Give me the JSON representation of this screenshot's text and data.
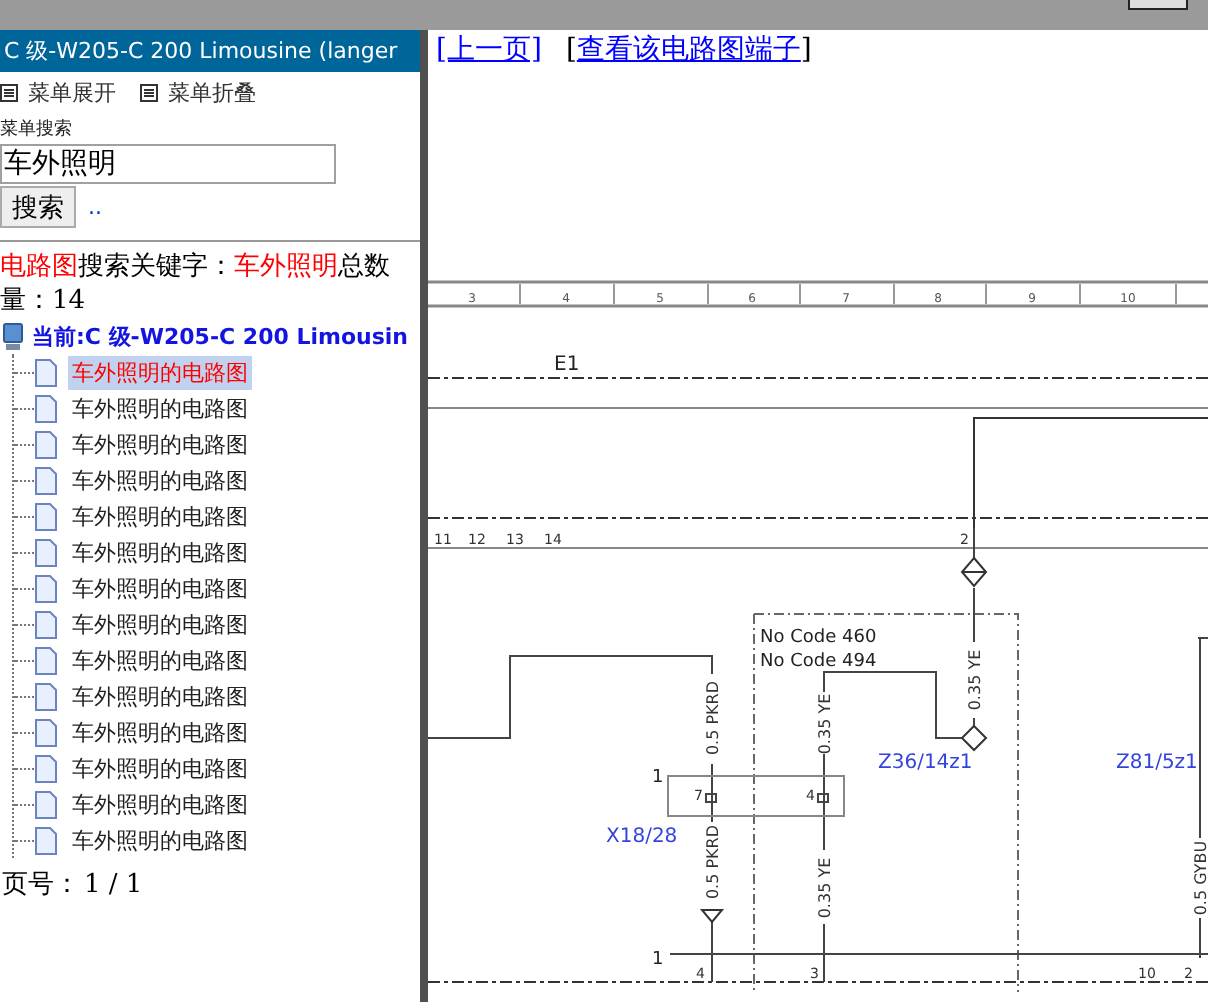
{
  "sidebar": {
    "title": "C 级-W205-C 200 Limousine (langer",
    "menu_actions": [
      "菜单展开",
      "菜单折叠"
    ],
    "search": {
      "label": "菜单搜索",
      "value": "车外照明",
      "button": "搜索",
      "more_link": ".."
    },
    "summary_parts": [
      {
        "text": "电路图",
        "highlight": true
      },
      {
        "text": "搜索关键字：",
        "highlight": false
      },
      {
        "text": "车外照明",
        "highlight": true
      },
      {
        "text": "总数量：14",
        "highlight": false
      }
    ],
    "tree": {
      "root": "当前:C 级-W205-C 200 Limousin",
      "children": [
        {
          "label": "车外照明的电路图",
          "selected": true
        },
        {
          "label": "车外照明的电路图",
          "selected": false
        },
        {
          "label": "车外照明的电路图",
          "selected": false
        },
        {
          "label": "车外照明的电路图",
          "selected": false
        },
        {
          "label": "车外照明的电路图",
          "selected": false
        },
        {
          "label": "车外照明的电路图",
          "selected": false
        },
        {
          "label": "车外照明的电路图",
          "selected": false
        },
        {
          "label": "车外照明的电路图",
          "selected": false
        },
        {
          "label": "车外照明的电路图",
          "selected": false
        },
        {
          "label": "车外照明的电路图",
          "selected": false
        },
        {
          "label": "车外照明的电路图",
          "selected": false
        },
        {
          "label": "车外照明的电路图",
          "selected": false
        },
        {
          "label": "车外照明的电路图",
          "selected": false
        },
        {
          "label": "车外照明的电路图",
          "selected": false
        }
      ]
    },
    "pager": {
      "label": "页号：",
      "value": "1 / 1"
    }
  },
  "nav_links": [
    {
      "text": "[上一页]"
    },
    {
      "prefix": "[",
      "text": "查看该电路图端子",
      "suffix": "]"
    }
  ],
  "diagram": {
    "column_numbers": [
      "3",
      "4",
      "5",
      "6",
      "7",
      "8",
      "9",
      "10"
    ],
    "labels": [
      {
        "text": "E1",
        "kind": "title"
      },
      {
        "text": "11",
        "kind": "pin"
      },
      {
        "text": "12",
        "kind": "pin"
      },
      {
        "text": "13",
        "kind": "pin"
      },
      {
        "text": "14",
        "kind": "pin"
      },
      {
        "text": "2",
        "kind": "pin"
      },
      {
        "text": "No Code 460",
        "kind": "note"
      },
      {
        "text": "No Code 494",
        "kind": "note"
      },
      {
        "text": "0.35 YE",
        "kind": "wire"
      },
      {
        "text": "Z36/14z1",
        "kind": "reference"
      },
      {
        "text": "0.5 PKRD",
        "kind": "wire"
      },
      {
        "text": "0.35 YE",
        "kind": "wire"
      },
      {
        "text": "1",
        "kind": "note"
      },
      {
        "text": "7",
        "kind": "pin"
      },
      {
        "text": "4",
        "kind": "pin"
      },
      {
        "text": "X18/28",
        "kind": "reference"
      },
      {
        "text": "0.5 PKRD",
        "kind": "wire"
      },
      {
        "text": "0.35 YE",
        "kind": "wire"
      },
      {
        "text": "Z81/5z1",
        "kind": "reference"
      },
      {
        "text": "0.5 GYBU",
        "kind": "wire"
      },
      {
        "text": "1",
        "kind": "note"
      },
      {
        "text": "4",
        "kind": "pin"
      },
      {
        "text": "3",
        "kind": "pin"
      },
      {
        "text": "10",
        "kind": "pin"
      },
      {
        "text": "2",
        "kind": "pin"
      }
    ]
  }
}
